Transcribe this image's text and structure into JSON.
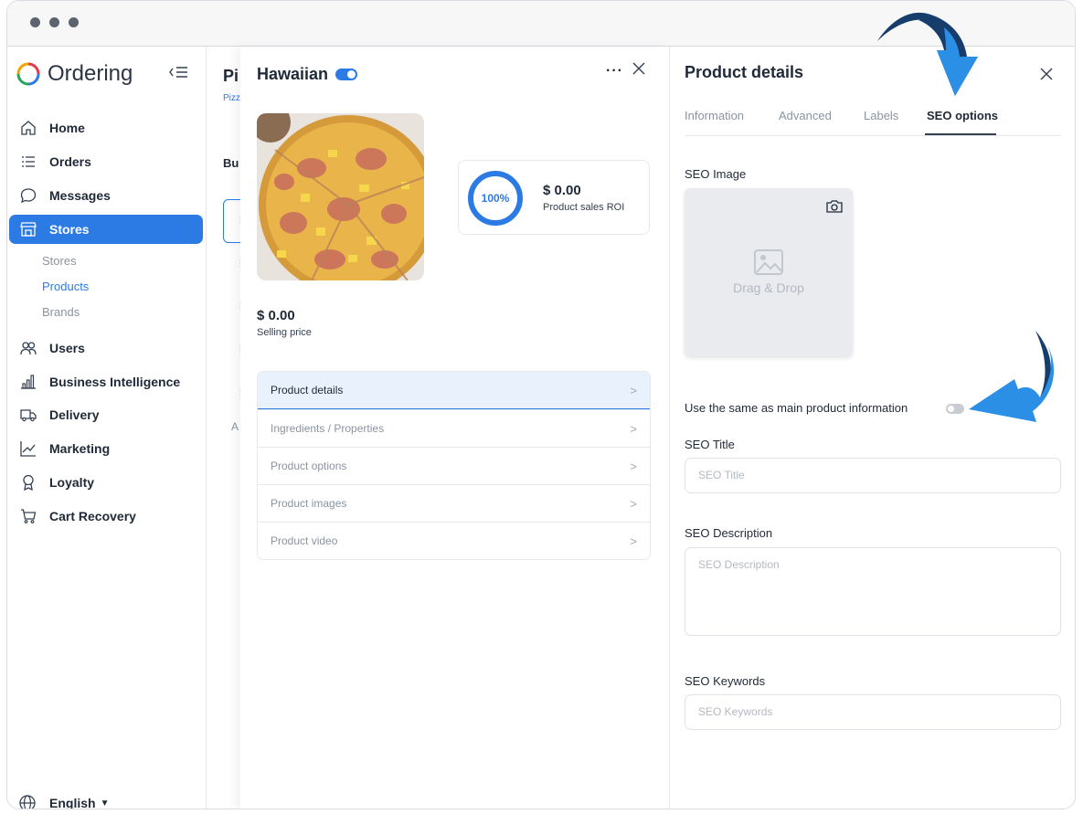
{
  "app": {
    "name": "Ordering"
  },
  "sidebar": {
    "items": [
      {
        "label": "Home",
        "icon": "home-icon"
      },
      {
        "label": "Orders",
        "icon": "list-icon"
      },
      {
        "label": "Messages",
        "icon": "chat-icon"
      },
      {
        "label": "Stores",
        "icon": "store-icon",
        "active": true
      },
      {
        "label": "Users",
        "icon": "users-icon"
      },
      {
        "label": "Business Intelligence",
        "icon": "bar-chart-icon"
      },
      {
        "label": "Delivery",
        "icon": "truck-icon"
      },
      {
        "label": "Marketing",
        "icon": "line-chart-icon"
      },
      {
        "label": "Loyalty",
        "icon": "award-icon"
      },
      {
        "label": "Cart Recovery",
        "icon": "cart-icon"
      }
    ],
    "subitems": [
      {
        "label": "Stores"
      },
      {
        "label": "Products",
        "active": true
      },
      {
        "label": "Brands"
      }
    ],
    "language": "English"
  },
  "background": {
    "title": "Pi",
    "breadcrumb": "Pizz",
    "section": "Bu",
    "letter": "A"
  },
  "product": {
    "name": "Hawaiian",
    "enabled": true,
    "roi_percent": "100%",
    "roi_value": "$ 0.00",
    "roi_label": "Product sales ROI",
    "price": "$ 0.00",
    "price_label": "Selling price",
    "menu": [
      {
        "label": "Product details"
      },
      {
        "label": "Ingredients / Properties"
      },
      {
        "label": "Product options"
      },
      {
        "label": "Product images"
      },
      {
        "label": "Product video"
      }
    ]
  },
  "details": {
    "title": "Product details",
    "tabs": [
      "Information",
      "Advanced",
      "Labels",
      "SEO options"
    ],
    "active_tab": "SEO options",
    "seo_image_label": "SEO Image",
    "drop_text": "Drag & Drop",
    "same_info_label": "Use the same as main product information",
    "same_info_enabled": false,
    "seo_title_label": "SEO Title",
    "seo_title_placeholder": "SEO Title",
    "seo_description_label": "SEO Description",
    "seo_description_placeholder": "SEO Description",
    "seo_keywords_label": "SEO Keywords",
    "seo_keywords_placeholder": "SEO Keywords"
  },
  "colors": {
    "accent": "#2c7be5",
    "arrow_dark": "#163d6b",
    "arrow_light": "#2c8fe6"
  }
}
